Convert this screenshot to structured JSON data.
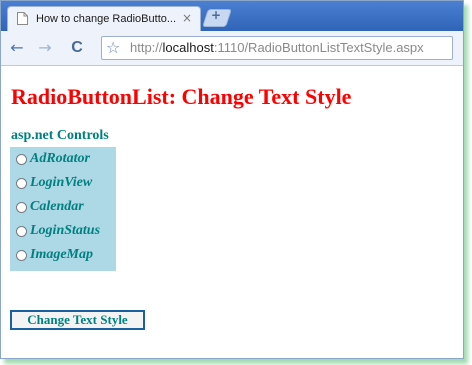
{
  "browser": {
    "tab_title": "How to change RadioButto...",
    "tab_close": "×",
    "new_tab": "+",
    "url_scheme": "http://",
    "url_host": "localhost",
    "url_path": ":1110/RadioButtonListTextStyle.aspx",
    "back_glyph": "←",
    "forward_glyph": "→",
    "reload_glyph": "C",
    "star_glyph": "☆"
  },
  "page": {
    "heading": "RadioButtonList: Change Text Style",
    "group_label": "asp.net Controls",
    "options": [
      "AdRotator",
      "LoginView",
      "Calendar",
      "LoginStatus",
      "ImageMap"
    ],
    "button_label": "Change Text Style"
  },
  "colors": {
    "heading": "#ff0000",
    "text": "#008080",
    "list_background": "#add8e6"
  }
}
